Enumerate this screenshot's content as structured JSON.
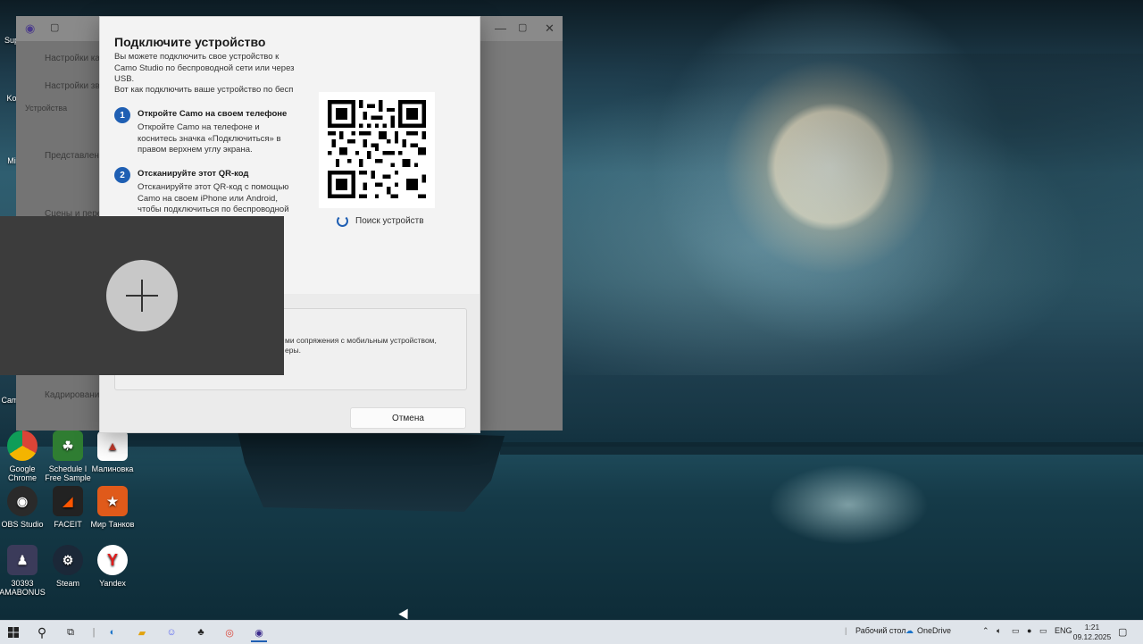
{
  "desktop": {
    "icons": [
      {
        "label": "Google Chrome",
        "color": "#db4437",
        "glyph": "●"
      },
      {
        "label": "Schedule I Free Sample",
        "color": "#2f7d32",
        "glyph": "☘"
      },
      {
        "label": "Малиновка",
        "color": "#c0392b",
        "glyph": "▲"
      },
      {
        "label": "OBS Studio",
        "color": "#2a2a2a",
        "glyph": "◉"
      },
      {
        "label": "FACEIT",
        "color": "#222222",
        "glyph": "◢"
      },
      {
        "label": "Мир Танков",
        "color": "#e05a1a",
        "glyph": "★"
      },
      {
        "label": "30393 AMABONUS",
        "color": "#3b3b5a",
        "glyph": "♟"
      },
      {
        "label": "Steam",
        "color": "#1b2838",
        "glyph": "⚙"
      },
      {
        "label": "Yandex",
        "color": "#ffffff",
        "glyph": "Y"
      }
    ],
    "partial_icons": [
      "Sup",
      "Ko",
      "Mi",
      "Cam"
    ]
  },
  "background_window": {
    "sidebar_items": [
      "Настройки кам",
      "Настройки зву",
      "Устройства",
      "Представлени",
      "Сцены и пере",
      "Кадрирование"
    ]
  },
  "dialog": {
    "title": "Подключите устройство",
    "intro": "Вы можете подключить свое устройство к Camo Studio по беспроводной сети или через USB.",
    "intro2": "Вот как подключить ваше устройство по бесп",
    "steps": [
      {
        "number": "1",
        "title": "Откройте Camo на своем телефоне",
        "desc": "Откройте Camo на телефоне и коснитесь значка «Подключиться» в правом верхнем углу экрана."
      },
      {
        "number": "2",
        "title": "Отсканируйте этот QR-код",
        "desc": "Отсканируйте этот QR-код с помощью Camo на своем iPhone или Android, чтобы подключиться по беспроводной"
      }
    ],
    "searching_label": "Поиск устройств",
    "info_text_line1": "ми сопряжения с мобильным устройством,",
    "info_text_line2": "еры.",
    "cancel_label": "Отмена"
  },
  "taskbar": {
    "desktop_label": "Рабочий стол",
    "onedrive_label": "OneDrive",
    "language": "ENG",
    "time": "1:21",
    "date": "09.12.2025"
  },
  "colors": {
    "accent": "#1f5fb3",
    "dialog_bg": "#f3f3f3",
    "overlay": "#3c3c3c"
  }
}
